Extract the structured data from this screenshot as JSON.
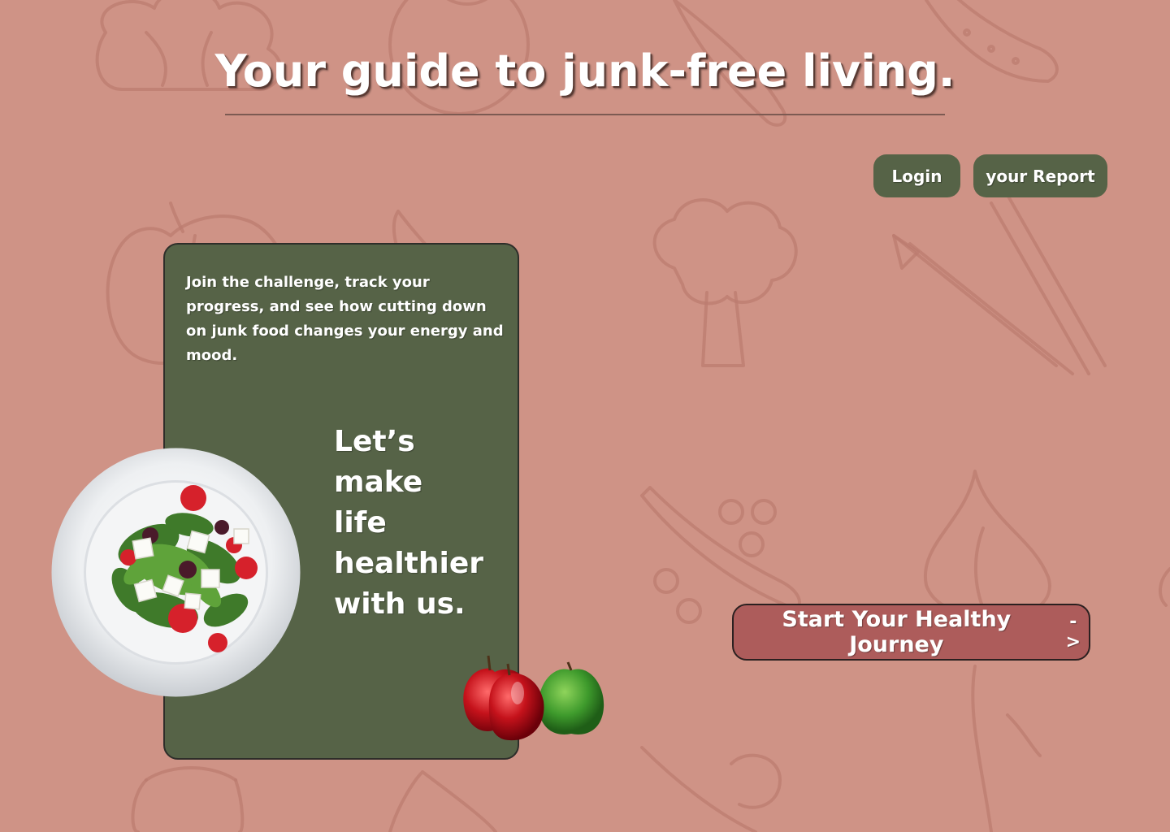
{
  "header": {
    "title": "Your guide to junk-free living."
  },
  "nav": {
    "login_label": "Login",
    "report_label": "your Report"
  },
  "card": {
    "intro": "Join the challenge, track your progress, and see how cutting down on junk food changes your energy and mood.",
    "headline_lines": [
      "Let’s",
      "make",
      "life",
      "healthier",
      "with us."
    ]
  },
  "cta": {
    "label": "Start Your Healthy Journey",
    "arrow": "->"
  },
  "theme": {
    "background": "#cf9386",
    "card": "#566347",
    "pill_button": "#566347",
    "cta_button": "#ad5c5b",
    "doodle_stroke": "#b57468"
  },
  "images": {
    "plate": "salad-plate-icon",
    "apples": "apples-icon"
  }
}
